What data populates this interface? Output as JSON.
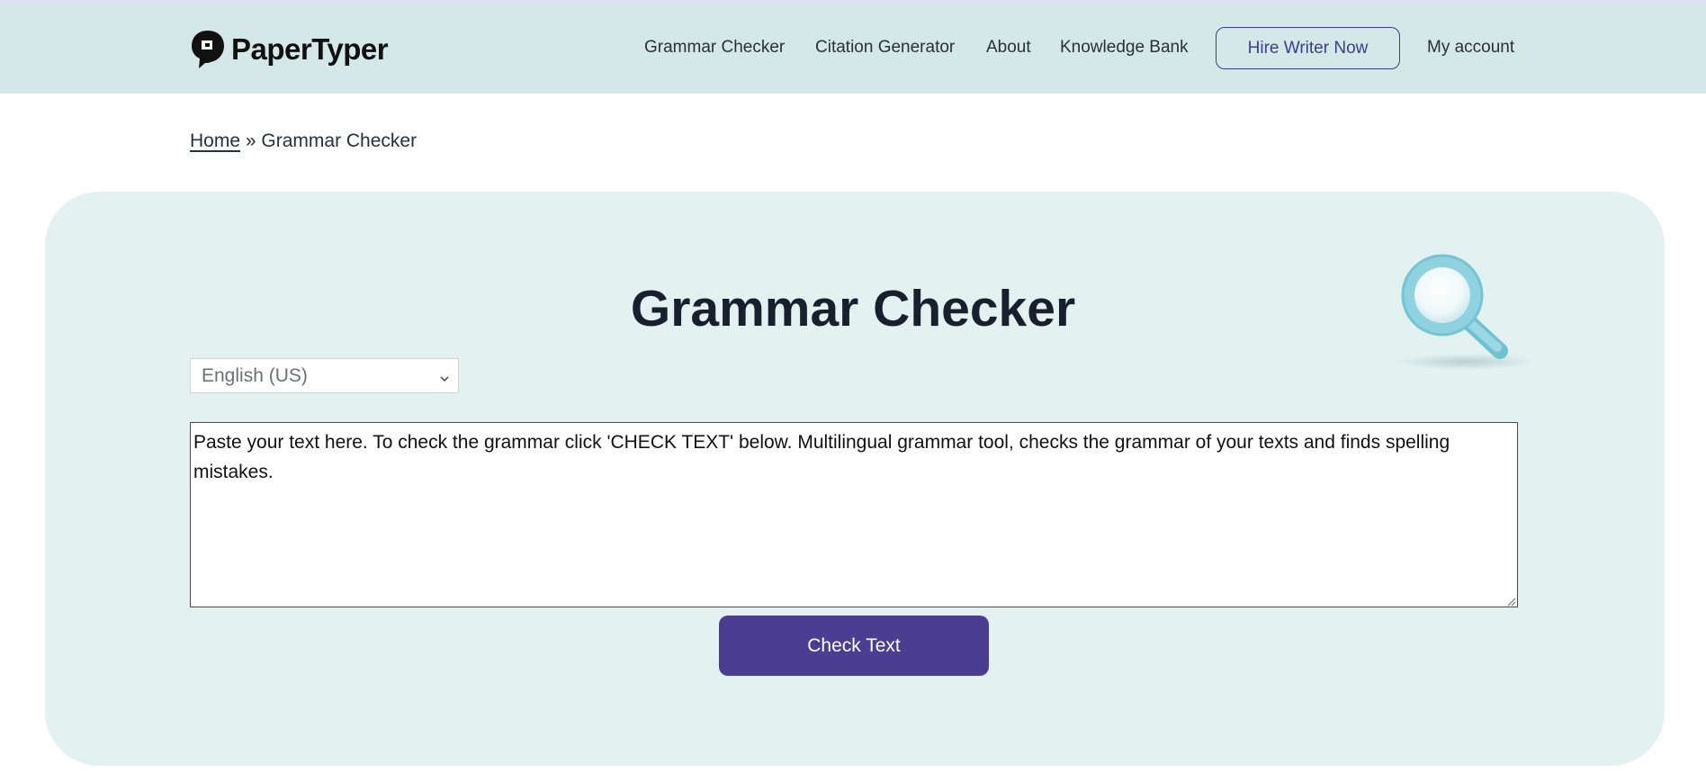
{
  "header": {
    "brand": "PaperTyper",
    "nav": [
      {
        "label": "Grammar Checker"
      },
      {
        "label": "Citation Generator"
      },
      {
        "label": "About"
      },
      {
        "label": "Knowledge Bank"
      }
    ],
    "hire_button": "Hire Writer Now",
    "account_link": "My account"
  },
  "breadcrumb": {
    "home": "Home",
    "separator": " » ",
    "current": "Grammar Checker"
  },
  "main": {
    "title": "Grammar Checker",
    "language_select": {
      "selected": "English (US)"
    },
    "textarea": {
      "value": "Paste your text here. To check the grammar click 'CHECK TEXT' below. Multilingual grammar tool, checks the grammar of your texts and finds spelling mistakes."
    },
    "check_button": "Check Text"
  },
  "colors": {
    "header_bg": "#d5e8e8",
    "panel_bg": "#e3f1f1",
    "accent": "#4b3e92",
    "hire_border": "#3e3d8a"
  },
  "icons": {
    "logo": "papertyper-logo-icon",
    "magnifier": "magnifying-glass-icon",
    "select_chevron": "chevron-down-icon"
  }
}
